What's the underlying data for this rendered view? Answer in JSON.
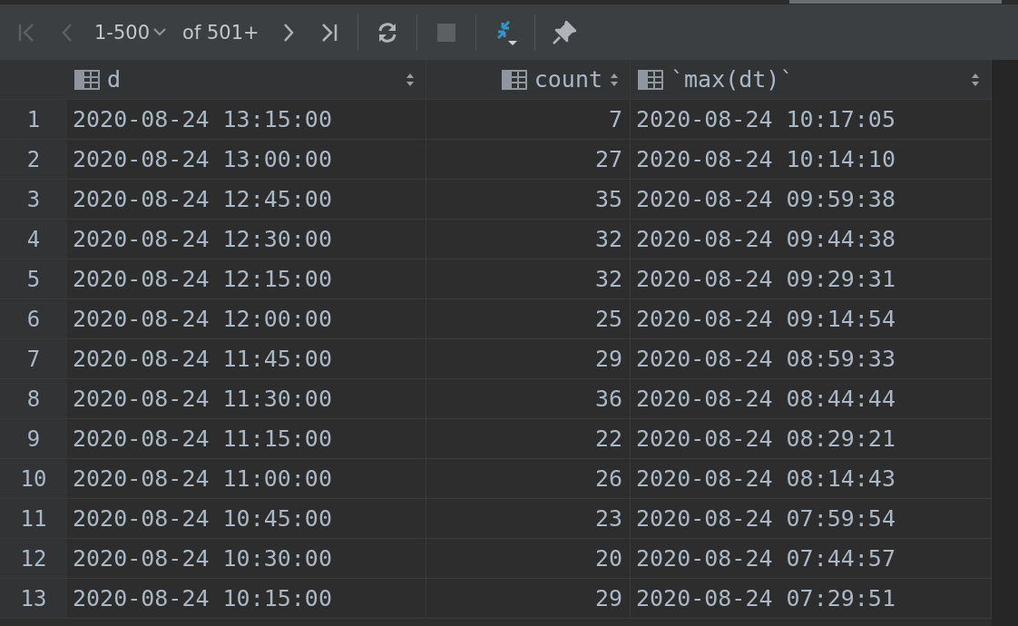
{
  "toolbar": {
    "first_disabled": true,
    "prev_disabled": true,
    "page_range": "1-500",
    "total": "of 501+",
    "next_disabled": false,
    "last_disabled": false,
    "stop_disabled": true
  },
  "table": {
    "columns": [
      {
        "label": "d",
        "kind": "text"
      },
      {
        "label": "count",
        "kind": "number"
      },
      {
        "label": "`max(dt)`",
        "kind": "text"
      }
    ],
    "rows": [
      {
        "number": "1",
        "cells": [
          "2020-08-24 13:15:00",
          "7",
          "2020-08-24 10:17:05"
        ]
      },
      {
        "number": "2",
        "cells": [
          "2020-08-24 13:00:00",
          "27",
          "2020-08-24 10:14:10"
        ]
      },
      {
        "number": "3",
        "cells": [
          "2020-08-24 12:45:00",
          "35",
          "2020-08-24 09:59:38"
        ]
      },
      {
        "number": "4",
        "cells": [
          "2020-08-24 12:30:00",
          "32",
          "2020-08-24 09:44:38"
        ]
      },
      {
        "number": "5",
        "cells": [
          "2020-08-24 12:15:00",
          "32",
          "2020-08-24 09:29:31"
        ]
      },
      {
        "number": "6",
        "cells": [
          "2020-08-24 12:00:00",
          "25",
          "2020-08-24 09:14:54"
        ]
      },
      {
        "number": "7",
        "cells": [
          "2020-08-24 11:45:00",
          "29",
          "2020-08-24 08:59:33"
        ]
      },
      {
        "number": "8",
        "cells": [
          "2020-08-24 11:30:00",
          "36",
          "2020-08-24 08:44:44"
        ]
      },
      {
        "number": "9",
        "cells": [
          "2020-08-24 11:15:00",
          "22",
          "2020-08-24 08:29:21"
        ]
      },
      {
        "number": "10",
        "cells": [
          "2020-08-24 11:00:00",
          "26",
          "2020-08-24 08:14:43"
        ]
      },
      {
        "number": "11",
        "cells": [
          "2020-08-24 10:45:00",
          "23",
          "2020-08-24 07:59:54"
        ]
      },
      {
        "number": "12",
        "cells": [
          "2020-08-24 10:30:00",
          "20",
          "2020-08-24 07:44:57"
        ]
      },
      {
        "number": "13",
        "cells": [
          "2020-08-24 10:15:00",
          "29",
          "2020-08-24 07:29:51"
        ]
      }
    ]
  }
}
